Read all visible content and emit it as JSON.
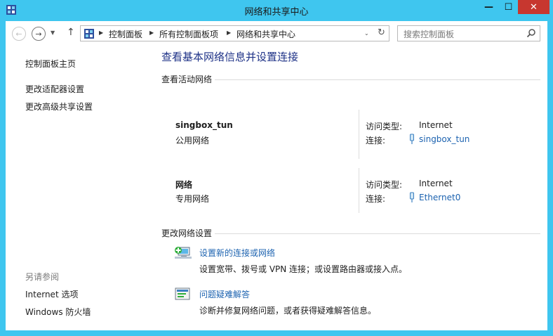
{
  "window": {
    "title": "网络和共享中心",
    "minimize_glyph": "—",
    "maximize_glyph": "☐",
    "close_glyph": "✕"
  },
  "nav": {
    "back_glyph": "←",
    "forward_glyph": "→",
    "up_glyph": "↑",
    "breadcrumbs": [
      "控制面板",
      "所有控制面板项",
      "网络和共享中心"
    ],
    "refresh_glyph": "↻"
  },
  "search": {
    "placeholder": "搜索控制面板"
  },
  "left_pane": {
    "home": "控制面板主页",
    "links": [
      "更改适配器设置",
      "更改高级共享设置"
    ],
    "see_also_title": "另请参阅",
    "see_also": [
      "Internet 选项",
      "Windows 防火墙"
    ]
  },
  "main": {
    "heading": "查看基本网络信息并设置连接",
    "active_title": "查看活动网络",
    "networks": [
      {
        "name": "singbox_tun",
        "type": "公用网络",
        "access_label": "访问类型:",
        "access_value": "Internet",
        "conn_label": "连接:",
        "conn_value": "singbox_tun"
      },
      {
        "name": "网络",
        "type": "专用网络",
        "access_label": "访问类型:",
        "access_value": "Internet",
        "conn_label": "连接:",
        "conn_value": "Ethernet0"
      }
    ],
    "change_title": "更改网络设置",
    "tasks": [
      {
        "link": "设置新的连接或网络",
        "desc": "设置宽带、拨号或 VPN 连接；或设置路由器或接入点。"
      },
      {
        "link": "问题疑难解答",
        "desc": "诊断并修复网络问题，或者获得疑难解答信息。"
      }
    ]
  },
  "colors": {
    "frame": "#3fc6ef",
    "link": "#1d63b0",
    "heading": "#1e3287",
    "close_button": "#c7372f"
  }
}
